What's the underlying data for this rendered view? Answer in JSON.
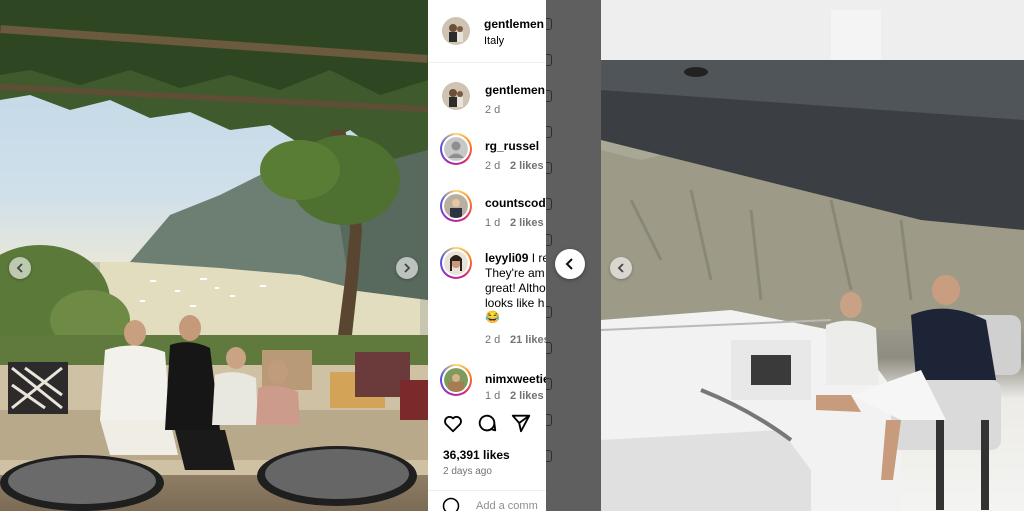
{
  "post": {
    "author": "gentlemen",
    "location": "Italy"
  },
  "caption": {
    "author": "gentlemen",
    "time": "2 d"
  },
  "comments": [
    {
      "user": "rg_russel",
      "time": "2 d",
      "likes": "2 likes",
      "text_lines": []
    },
    {
      "user": "countscode",
      "time": "1 d",
      "likes": "2 likes",
      "text_lines": []
    },
    {
      "user": "leyyli09",
      "time": "2 d",
      "likes": "21 likes",
      "text_lines": [
        "I re",
        "They're am",
        "great! Altho",
        "looks like h",
        "😂"
      ]
    },
    {
      "user": "nimxweetie",
      "time": "1 d",
      "likes": "2 likes",
      "text_lines": []
    }
  ],
  "actions": {
    "like_icon": "heart-icon",
    "comment_icon": "comment-icon",
    "share_icon": "share-icon"
  },
  "stats": {
    "likes": "36,391 likes",
    "time_ago": "2 days ago"
  },
  "add_comment_placeholder": "Add a comm",
  "navigation": {
    "prev_icon": "chevron-left-icon",
    "next_icon": "chevron-right-icon"
  }
}
